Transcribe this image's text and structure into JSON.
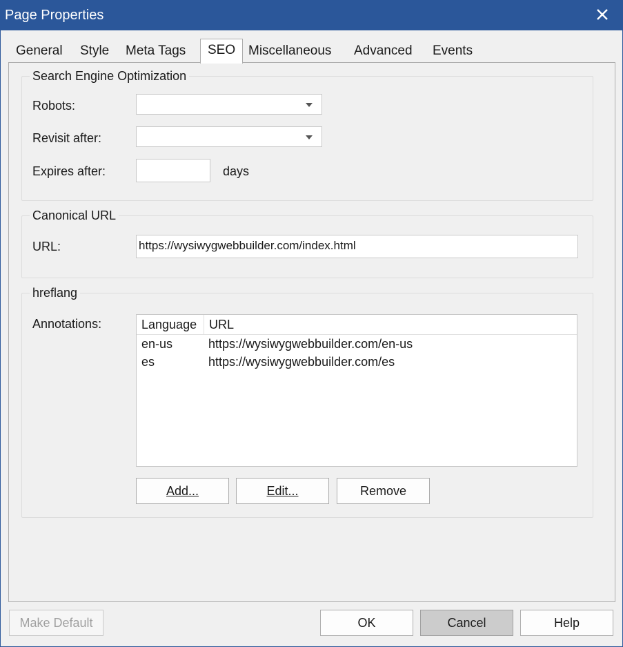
{
  "window": {
    "title": "Page Properties",
    "close_icon": "close-icon",
    "accent": "#2b579a"
  },
  "tabs": [
    {
      "label": "General",
      "active": false
    },
    {
      "label": "Style",
      "active": false
    },
    {
      "label": "Meta Tags",
      "active": false
    },
    {
      "label": "SEO",
      "active": true
    },
    {
      "label": "Miscellaneous",
      "active": false
    },
    {
      "label": "Advanced",
      "active": false
    },
    {
      "label": "Events",
      "active": false
    }
  ],
  "seo_group": {
    "legend": "Search Engine Optimization",
    "robots_label": "Robots:",
    "robots_value": "",
    "revisit_label": "Revisit after:",
    "revisit_value": "",
    "expires_label": "Expires after:",
    "expires_value": "",
    "expires_unit": "days"
  },
  "canonical_group": {
    "legend": "Canonical URL",
    "url_label": "URL:",
    "url_value": "https://wysiwygwebbuilder.com/index.html"
  },
  "hreflang_group": {
    "legend": "hreflang",
    "annotations_label": "Annotations:",
    "columns": [
      "Language",
      "URL"
    ],
    "rows": [
      {
        "language": "en-us",
        "url": "https://wysiwygwebbuilder.com/en-us"
      },
      {
        "language": "es",
        "url": "https://wysiwygwebbuilder.com/es"
      }
    ],
    "add_label": "Add...",
    "edit_label": "Edit...",
    "remove_label": "Remove"
  },
  "footer": {
    "make_default_label": "Make Default",
    "ok_label": "OK",
    "cancel_label": "Cancel",
    "help_label": "Help"
  }
}
